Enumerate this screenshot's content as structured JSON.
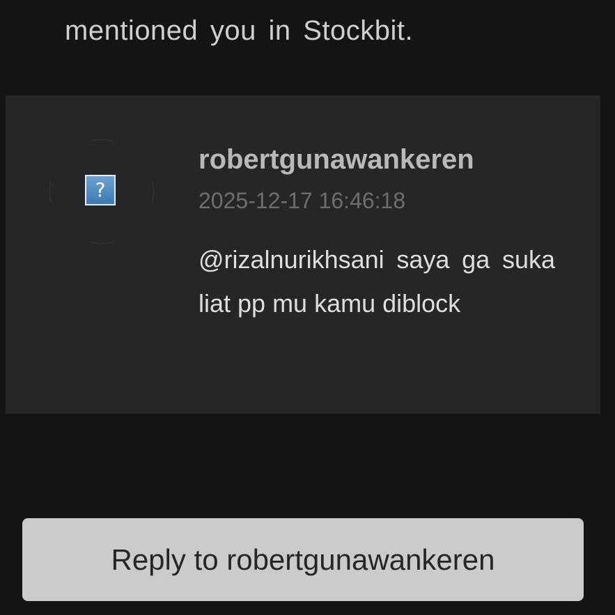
{
  "notification": {
    "intro_text": "mentioned you in Stockbit."
  },
  "comment": {
    "avatar_icon": "broken-image-icon",
    "avatar_glyph": "?",
    "username": "robertgunawankeren",
    "timestamp": "2025-12-17 16:46:18",
    "body": "@rizalnurikhsani saya ga suka liat pp mu kamu diblock"
  },
  "actions": {
    "reply_label": "Reply to robertgunawankeren"
  },
  "colors": {
    "background": "#141414",
    "card": "#252628",
    "button": "#cbcbcb"
  }
}
